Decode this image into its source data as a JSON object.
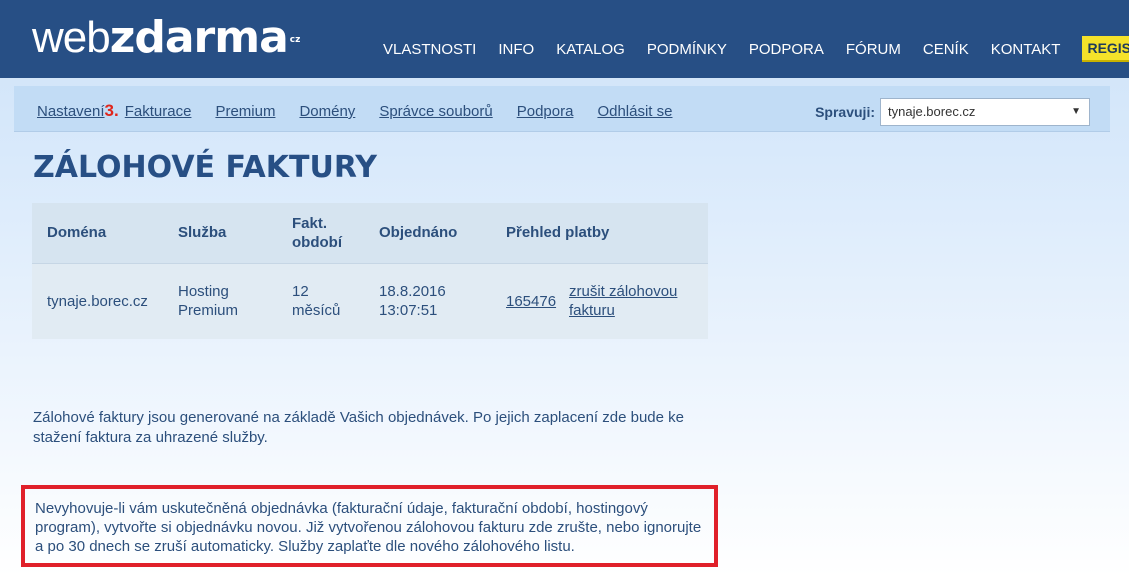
{
  "header": {
    "logo_part1": "web",
    "logo_part2": "zdarma",
    "logo_tld": "cz",
    "nav": [
      "VLASTNOSTI",
      "INFO",
      "KATALOG",
      "PODMÍNKY",
      "PODPORA",
      "FÓRUM",
      "CENÍK",
      "KONTAKT"
    ],
    "register_label": "REGISTRACE"
  },
  "subnav": {
    "items": [
      "Nastavení",
      "Fakturace",
      "Premium",
      "Domény",
      "Správce souborů",
      "Podpora",
      "Odhlásit se"
    ],
    "step_marker": "3.",
    "manages_label": "Spravuji:",
    "manages_value": "tynaje.borec.cz",
    "dropdown_arrow": "▼"
  },
  "page": {
    "title": "ZÁLOHOVÉ FAKTURY"
  },
  "table": {
    "headers": [
      "Doména",
      "Služba",
      "Fakt. období",
      "Objednáno",
      "Přehled platby"
    ],
    "rows": [
      {
        "domain": "tynaje.borec.cz",
        "service": "Hosting Premium",
        "period": "12 měsíců",
        "ordered": "18.8.2016 13:07:51",
        "payment_id": "165476",
        "cancel_link": "zrušit zálohovou fakturu"
      }
    ]
  },
  "info_text": "Zálohové faktury jsou generované na základě Vašich objednávek. Po jejich zaplacení zde bude ke stažení faktura za uhrazené služby.",
  "notice_text": "Nevyhovuje-li vám uskutečněná objednávka (fakturační údaje, fakturační období, hostingový program), vytvořte si objednávku novou. Již vytvořenou zálohovou fakturu zde zrušte, nebo ignorujte a po 30 dnech se zruší automaticky. Služby zaplaťte dle nového zálohového listu.",
  "colors": {
    "header_bg": "#274f85",
    "register_bg": "#f5e22a",
    "highlight_border": "#e0202a",
    "step_marker": "#e0251b"
  }
}
